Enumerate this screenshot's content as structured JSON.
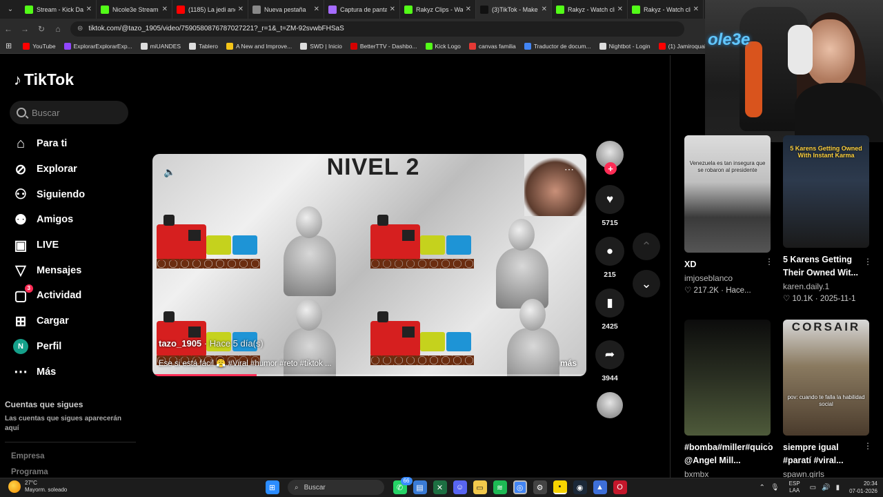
{
  "browser": {
    "tabs": [
      {
        "label": "Stream - Kick Da",
        "color": "#53fc18",
        "active": false
      },
      {
        "label": "Nicole3e Stream",
        "color": "#53fc18",
        "active": false
      },
      {
        "label": "(1185) La jedi and",
        "color": "#ff0000",
        "active": false
      },
      {
        "label": "Nueva pestaña",
        "color": "#888888",
        "active": false
      },
      {
        "label": "Captura de panta",
        "color": "#a56bff",
        "active": false
      },
      {
        "label": "Rakyz Clips - Wat",
        "color": "#53fc18",
        "active": false
      },
      {
        "label": "(3)TikTok - Make",
        "color": "#111111",
        "active": true
      },
      {
        "label": "Rakyz - Watch cli",
        "color": "#53fc18",
        "active": false
      },
      {
        "label": "Rakyz - Watch cli",
        "color": "#53fc18",
        "active": false
      }
    ],
    "url": "tiktok.com/@tazo_1905/video/7590580876787027221?_r=1&_t=ZM-92svwbFHSaS",
    "bookmarks": [
      {
        "label": "YouTube",
        "color": "#ff0000"
      },
      {
        "label": "ExplorarExplorarExp...",
        "color": "#9146ff"
      },
      {
        "label": "miUANDES",
        "color": "#dddddd"
      },
      {
        "label": "Tablero",
        "color": "#dddddd"
      },
      {
        "label": "A New and Improve...",
        "color": "#f5c518"
      },
      {
        "label": "SWD | Inicio",
        "color": "#dddddd"
      },
      {
        "label": "BetterTTV - Dashbo...",
        "color": "#d50000"
      },
      {
        "label": "Kick Logo",
        "color": "#53fc18"
      },
      {
        "label": "canvas familia",
        "color": "#e53935"
      },
      {
        "label": "Traductor de docum...",
        "color": "#4285f4"
      },
      {
        "label": "Nightbot - Login",
        "color": "#dddddd"
      },
      {
        "label": "(1) Jamiroquai - Can...",
        "color": "#ff0000"
      }
    ]
  },
  "tiktok": {
    "brand": "TikTok",
    "search_placeholder": "Buscar",
    "nav": [
      {
        "label": "Para ti",
        "icon": "home-icon"
      },
      {
        "label": "Explorar",
        "icon": "compass-icon"
      },
      {
        "label": "Siguiendo",
        "icon": "following-icon"
      },
      {
        "label": "Amigos",
        "icon": "friends-icon"
      },
      {
        "label": "LIVE",
        "icon": "live-icon"
      },
      {
        "label": "Mensajes",
        "icon": "messages-icon"
      },
      {
        "label": "Actividad",
        "icon": "activity-icon",
        "badge": "3"
      },
      {
        "label": "Cargar",
        "icon": "upload-icon"
      },
      {
        "label": "Perfil",
        "icon": "profile-avatar",
        "avatar_letter": "N"
      },
      {
        "label": "Más",
        "icon": "more-icon"
      }
    ],
    "following_title": "Cuentas que sigues",
    "following_desc": "Las cuentas que sigues aparecerán aquí",
    "footer": [
      "Empresa",
      "Programa"
    ]
  },
  "video": {
    "overlay_title": "NIVEL 2",
    "author": "tazo_1905",
    "posted": "· Hace 5 día(s)",
    "description": "Ese si está fácil 😤 #Viral #humor #reto #tiktok ...",
    "more": "más",
    "progress": 0.24,
    "likes": "5715",
    "comments": "215",
    "saves": "2425",
    "shares": "3944"
  },
  "facecam": {
    "logo": "ole3e"
  },
  "recommendations": [
    {
      "title": "XD",
      "author": "imjoseblanco",
      "views": "217.2K",
      "date": "Hace...",
      "thumb_text": "Venezuela es tan insegura que se robaron al presidente"
    },
    {
      "title": "5 Karens Getting Their Owned Wit...",
      "author": "karen.daily.1",
      "views": "10.1K",
      "date": "2025-11-1",
      "thumb_text": "5 Karens Getting Owned With Instant Karma"
    },
    {
      "title": "#bomba#miller#quico @Angel Mill...",
      "author": "bxmbx",
      "thumb_text": ""
    },
    {
      "title": "siempre igual #paratí #viral...",
      "author": "spawn.girls",
      "thumb_text": "pov: cuando te falla la habilidad social"
    }
  ],
  "taskbar": {
    "temp": "27°C",
    "weather": "Mayorm. soleado",
    "search": "Buscar",
    "lang1": "ESP",
    "lang2": "LAA",
    "time": "20:34",
    "date": "07-01-2026",
    "chat_badge": "66"
  }
}
